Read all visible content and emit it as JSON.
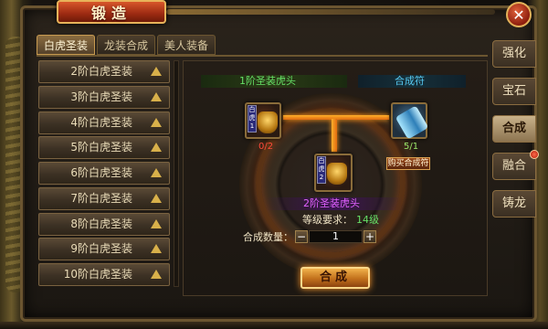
{
  "window": {
    "title": "锻造",
    "close_glyph": "✕"
  },
  "top_tabs": [
    {
      "label": "白虎圣装",
      "active": true
    },
    {
      "label": "龙装合成",
      "active": false
    },
    {
      "label": "美人装备",
      "active": false
    }
  ],
  "list_items": [
    "2阶白虎圣装",
    "3阶白虎圣装",
    "4阶白虎圣装",
    "5阶白虎圣装",
    "6阶白虎圣装",
    "7阶白虎圣装",
    "8阶白虎圣装",
    "9阶白虎圣装",
    "10阶白虎圣装"
  ],
  "forge": {
    "material_label": "1阶圣装虎头",
    "material_count": "0/2",
    "material_badge": "白虎1",
    "catalyst_label": "合成符",
    "catalyst_count": "5/1",
    "buy_button": "购买合成符",
    "result_label": "2阶圣装虎头",
    "result_badge": "白虎2",
    "level_req_label": "等级要求：",
    "level_req_value": "14级",
    "qty_label": "合成数量：",
    "qty_value": "1",
    "qty_minus": "−",
    "qty_plus": "+",
    "synth_button": "合成"
  },
  "side_tabs": [
    {
      "label": "强化",
      "active": false,
      "dot": false
    },
    {
      "label": "宝石",
      "active": false,
      "dot": false
    },
    {
      "label": "合成",
      "active": true,
      "dot": false
    },
    {
      "label": "融合",
      "active": false,
      "dot": true
    },
    {
      "label": "铸龙",
      "active": false,
      "dot": false
    }
  ],
  "colors": {
    "accent_orange": "#ff9a1a",
    "green_text": "#66e066",
    "cyan_text": "#56c8f0",
    "purple_text": "#e060ff",
    "red_text": "#ff4a3a"
  }
}
